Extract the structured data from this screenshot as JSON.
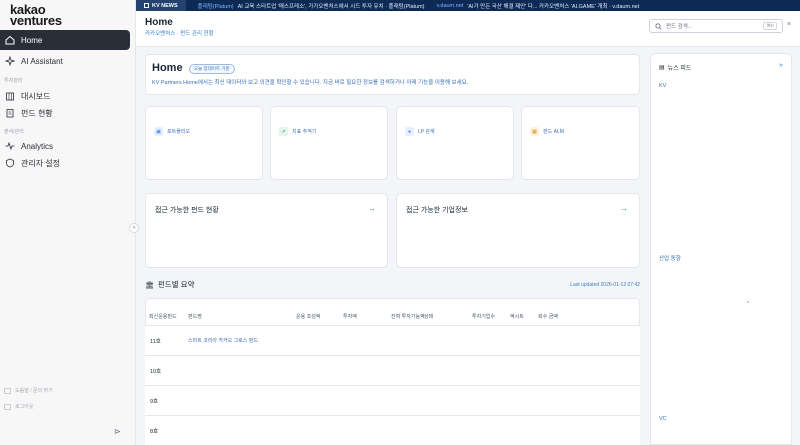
{
  "brand": {
    "line1": "kakao",
    "line2": "ventures"
  },
  "sidebar": {
    "items": [
      {
        "label": "Home",
        "icon": "home-icon"
      },
      {
        "label": "AI Assistant",
        "icon": "sparkle-icon"
      }
    ],
    "sections": [
      {
        "label": "투자관리",
        "items": [
          {
            "label": "대시보드",
            "icon": "building-icon"
          },
          {
            "label": "펀드 현황",
            "icon": "document-icon"
          }
        ]
      },
      {
        "label": "분석/관리",
        "items": [
          {
            "label": "Analytics",
            "icon": "pulse-icon"
          },
          {
            "label": "관리자 설정",
            "icon": "shield-icon"
          }
        ]
      }
    ],
    "footer": [
      {
        "label": "도움말 / 문의 하기"
      },
      {
        "label": "로그아웃"
      }
    ],
    "collapse_glyph": "«",
    "panel_toggle_glyph": "⊳"
  },
  "ticker": {
    "tag": "KV NEWS",
    "items": [
      {
        "source": "플래텀(Platum)",
        "text": "AI 교육 스타트업 '매스프레소', 가가오벤처스에서 시드 투자 유치 · 플래텀(Platum)"
      },
      {
        "source": "v.daum.net",
        "text": "'AI가 만든 국산 해결 제안' 다... 카카오벤처스 'AI.GAME' 개최 · v.daum.net"
      }
    ]
  },
  "header": {
    "title": "Home",
    "breadcrumb": "카카오벤처스 · 펀드 관리 현황",
    "search_placeholder": "펀드 검색...",
    "search_shortcut": "⌘K"
  },
  "home_card": {
    "title": "Home",
    "badge": "오늘 업데이트 기준",
    "description": "KV Partners Home에서는 최신 데이터와 보고 의견을 확인할 수 있습니다. 지금 바로 필요한 정보를 검색하거나 아래 기능을 이용해 보세요."
  },
  "quick_cards": [
    {
      "label": "포트폴리오",
      "icon": "briefcase-icon",
      "color": "#3b82f6",
      "bg": "#e7f0fe"
    },
    {
      "label": "지표 추적기",
      "icon": "chart-icon",
      "color": "#22a06b",
      "bg": "#e4f6ec"
    },
    {
      "label": "LP 관계",
      "icon": "users-icon",
      "color": "#3b82f6",
      "bg": "#e7f0fe"
    },
    {
      "label": "펀드 ALM",
      "icon": "calendar-icon",
      "color": "#d98a00",
      "bg": "#fdf1dc"
    }
  ],
  "sections": [
    {
      "title": "접근 가능한 펀드 현황",
      "arrow": "→"
    },
    {
      "title": "접근 가능한 기업정보",
      "arrow": "→"
    }
  ],
  "summary": {
    "title": "펀드별 요약",
    "updated": "Last updated 2026-01-12 07:42",
    "columns": [
      "최신운용펀드",
      "펀드명",
      "운용 조성액",
      "투자액",
      "잔여 투자가능액",
      "상태",
      "투자기업수",
      "엑시트",
      "회수 금액"
    ],
    "rows": [
      {
        "fund": "11호",
        "name": "스마트 코리아 카카오 그로스 펀드"
      },
      {
        "fund": "10호",
        "name": ""
      },
      {
        "fund": "9호",
        "name": ""
      },
      {
        "fund": "8호",
        "name": ""
      }
    ]
  },
  "news_panel": {
    "title": "뉴스 피드",
    "expand": "»",
    "sections": [
      "KV",
      "산업 동향",
      "VC"
    ]
  }
}
